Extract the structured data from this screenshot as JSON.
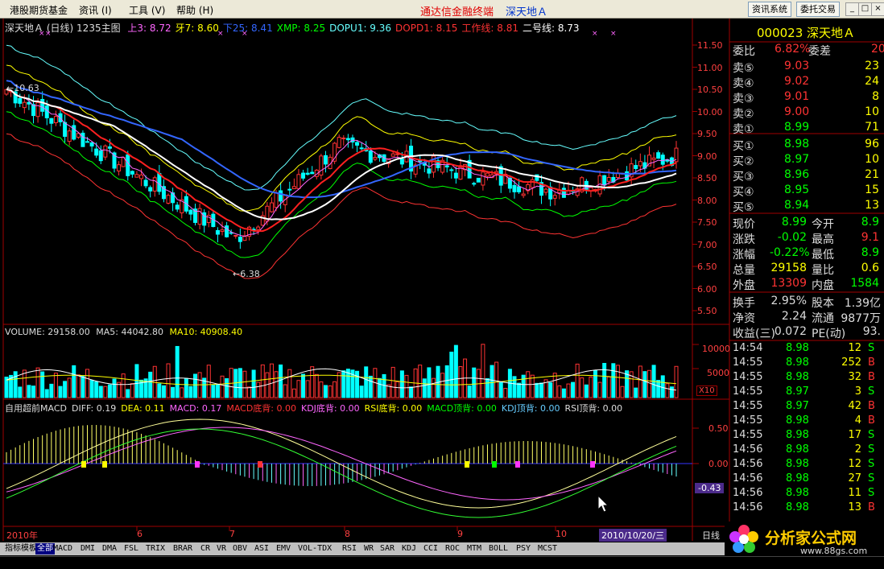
{
  "menu": {
    "items": [
      "港股期货基金",
      "资讯 (I)",
      "工具 (V)",
      "帮助 (H)"
    ],
    "brand": "通达信金融终端",
    "stock_title": "深天地Ａ",
    "buttons": [
      "资讯系统",
      "委托交易"
    ]
  },
  "header": {
    "name": "深天地Ａ",
    "period": "(日线)",
    "mode": "1235主图",
    "indicators": [
      {
        "label": "上3: 8.72",
        "color": "#ff66ff"
      },
      {
        "label": "牙7: 8.60",
        "color": "#ffff00"
      },
      {
        "label": "下25: 8.41",
        "color": "#3366ff"
      },
      {
        "label": "XMP: 8.25",
        "color": "#00ff00"
      },
      {
        "label": "DOPU1: 9.36",
        "color": "#66ffff"
      },
      {
        "label": "DOPD1: 8.15",
        "color": "#ff3333"
      },
      {
        "label": "工作线: 8.81",
        "color": "#ff3333"
      },
      {
        "label": "二号线: 8.73",
        "color": "#ffffff"
      }
    ]
  },
  "price_axis": [
    "11.50",
    "11.00",
    "10.50",
    "10.00",
    "9.50",
    "9.00",
    "8.50",
    "8.00",
    "7.50",
    "7.00",
    "6.50",
    "6.00",
    "5.50"
  ],
  "price_markers": {
    "high": "10.63",
    "low": "6.38"
  },
  "volume": {
    "header_label": "VOLUME: 29158.00",
    "ma5": "MA5: 44042.80",
    "ma10": "MA10: 40908.40",
    "axis": [
      "10000",
      "5000"
    ],
    "unit": "X10"
  },
  "macd": {
    "header": [
      {
        "label": "自用超前MACD",
        "color": "#dddddd"
      },
      {
        "label": "DIFF: 0.19",
        "color": "#dddddd"
      },
      {
        "label": "DEA: 0.11",
        "color": "#ffff00"
      },
      {
        "label": "MACD: 0.17",
        "color": "#ff66ff"
      },
      {
        "label": "MACD底背: 0.00",
        "color": "#ff3333"
      },
      {
        "label": "KDJ底背: 0.00",
        "color": "#ff66ff"
      },
      {
        "label": "RSI底背: 0.00",
        "color": "#ffff00"
      },
      {
        "label": "MACD顶背: 0.00",
        "color": "#00ff00"
      },
      {
        "label": "KDJ顶背: 0.00",
        "color": "#66ccff"
      },
      {
        "label": "RSI顶背: 0.00",
        "color": "#dddddd"
      }
    ],
    "axis": [
      "0.50",
      "0.00"
    ],
    "current": "-0.43"
  },
  "date_axis": {
    "labels": [
      "2010年",
      "6",
      "7",
      "8",
      "9",
      "10"
    ],
    "cursor_date": "2010/10/20/三",
    "period_label": "日线"
  },
  "tabs": [
    "指标",
    "模板",
    "全部",
    "MACD",
    "DMI",
    "DMA",
    "FSL",
    "TRIX",
    "BRAR",
    "CR",
    "VR",
    "OBV",
    "ASI",
    "EMV",
    "VOL-TDX",
    "RSI",
    "WR",
    "SAR",
    "KDJ",
    "CCI",
    "ROC",
    "MTM",
    "BOLL",
    "PSY",
    "MCST"
  ],
  "quote": {
    "code_name": "000023 深天地Ａ",
    "weibi_label": "委比",
    "weibi": "6.82%",
    "weicha_label": "委差",
    "weicha": "20",
    "asks": [
      {
        "label": "卖⑤",
        "price": "9.03",
        "vol": "23"
      },
      {
        "label": "卖④",
        "price": "9.02",
        "vol": "24"
      },
      {
        "label": "卖③",
        "price": "9.01",
        "vol": "8"
      },
      {
        "label": "卖②",
        "price": "9.00",
        "vol": "10"
      },
      {
        "label": "卖①",
        "price": "8.99",
        "vol": "71"
      }
    ],
    "bids": [
      {
        "label": "买①",
        "price": "8.98",
        "vol": "96"
      },
      {
        "label": "买②",
        "price": "8.97",
        "vol": "10"
      },
      {
        "label": "买③",
        "price": "8.96",
        "vol": "21"
      },
      {
        "label": "买④",
        "price": "8.95",
        "vol": "15"
      },
      {
        "label": "买⑤",
        "price": "8.94",
        "vol": "13"
      }
    ],
    "stats": [
      {
        "l1": "现价",
        "v1": "8.99",
        "c1": "#00ff00",
        "l2": "今开",
        "v2": "8.9",
        "c2": "#00ff00"
      },
      {
        "l1": "涨跌",
        "v1": "-0.02",
        "c1": "#00ff00",
        "l2": "最高",
        "v2": "9.1",
        "c2": "#ff3333"
      },
      {
        "l1": "涨幅",
        "v1": "-0.22%",
        "c1": "#00ff00",
        "l2": "最低",
        "v2": "8.9",
        "c2": "#00ff00"
      },
      {
        "l1": "总量",
        "v1": "29158",
        "c1": "#ffff00",
        "l2": "量比",
        "v2": "0.6",
        "c2": "#ffff00"
      },
      {
        "l1": "外盘",
        "v1": "13309",
        "c1": "#ff3333",
        "l2": "内盘",
        "v2": "1584",
        "c2": "#00ff00"
      }
    ],
    "fundamentals": [
      {
        "l1": "换手",
        "v1": "2.95%",
        "l2": "股本",
        "v2": "1.39亿"
      },
      {
        "l1": "净资",
        "v1": "2.24",
        "l2": "流通",
        "v2": "9877万"
      },
      {
        "l1": "收益(三)",
        "v1": "0.072",
        "l2": "PE(动)",
        "v2": "93."
      }
    ],
    "ticks": [
      {
        "time": "14:54",
        "price": "8.98",
        "vol": "12",
        "side": "S"
      },
      {
        "time": "14:55",
        "price": "8.98",
        "vol": "252",
        "side": "B"
      },
      {
        "time": "14:55",
        "price": "8.98",
        "vol": "32",
        "side": "B"
      },
      {
        "time": "14:55",
        "price": "8.97",
        "vol": "3",
        "side": "S"
      },
      {
        "time": "14:55",
        "price": "8.97",
        "vol": "42",
        "side": "B"
      },
      {
        "time": "14:55",
        "price": "8.98",
        "vol": "4",
        "side": "B"
      },
      {
        "time": "14:55",
        "price": "8.98",
        "vol": "17",
        "side": "S"
      },
      {
        "time": "14:56",
        "price": "8.98",
        "vol": "2",
        "side": "S"
      },
      {
        "time": "14:56",
        "price": "8.98",
        "vol": "12",
        "side": "S"
      },
      {
        "time": "14:56",
        "price": "8.98",
        "vol": "27",
        "side": "S"
      },
      {
        "time": "14:56",
        "price": "8.98",
        "vol": "11",
        "side": "S"
      },
      {
        "time": "14:56",
        "price": "8.98",
        "vol": "13",
        "side": "B"
      }
    ]
  },
  "watermark": {
    "title": "分析家公式网",
    "url": "www.88gs.com"
  },
  "colors": {
    "up": "#ff3333",
    "down": "#00ffff",
    "grid": "#a00000",
    "axis": "#ff4040"
  }
}
